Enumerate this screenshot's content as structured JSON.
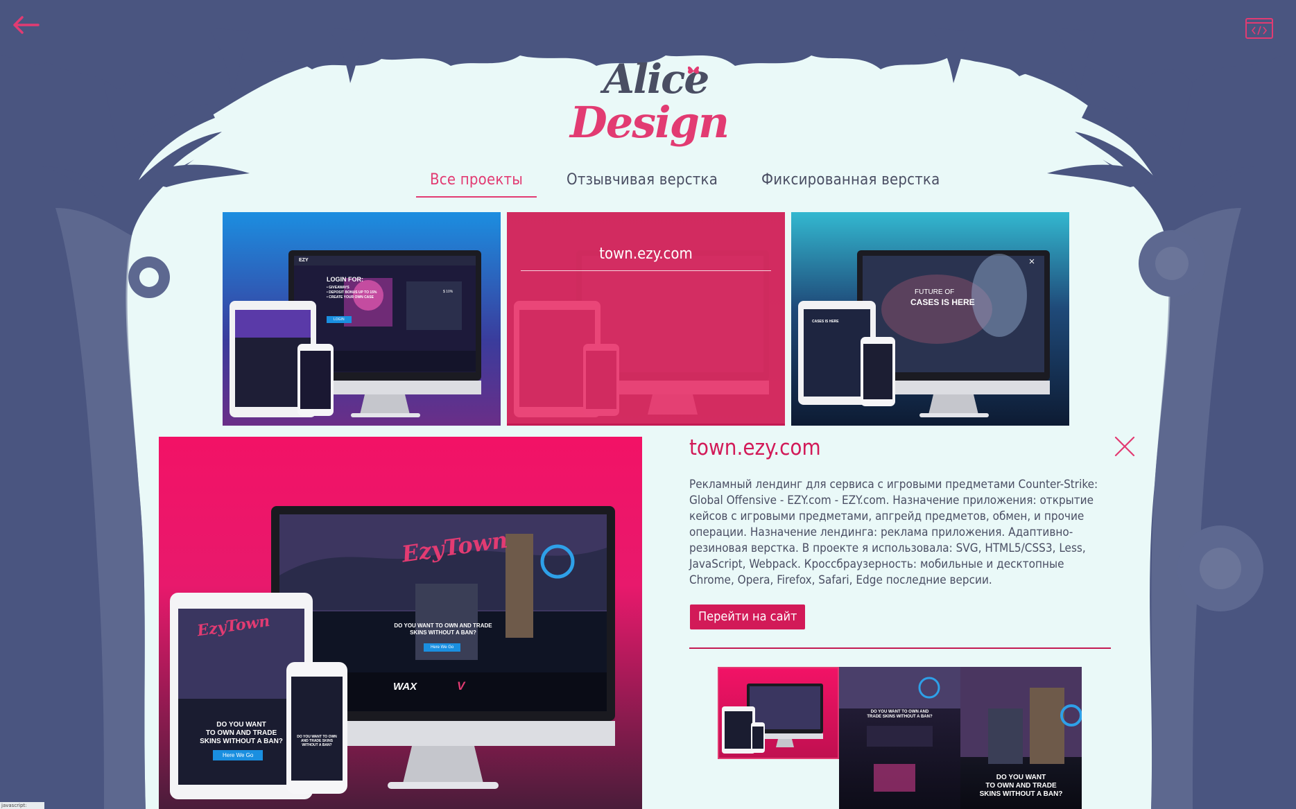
{
  "logo": {
    "line1": "Alice",
    "line2": "Design"
  },
  "tabs": [
    {
      "label": "Все проекты",
      "active": true
    },
    {
      "label": "Отзывчивая верстка",
      "active": false
    },
    {
      "label": "Фиксированная верстка",
      "active": false
    }
  ],
  "projects": [
    {
      "mock": {
        "logo": "EZY",
        "heading": "LOGIN FOR:",
        "bullets": [
          "• GIVEAWAYS",
          "• DEPOSIT BONUS UP TO 15%",
          "• CREATE YOUR OWN CASE"
        ],
        "cta": "LOGIN",
        "price": "$ 10%"
      }
    },
    {
      "title": "town.ezy.com"
    },
    {
      "mock": {
        "line1": "FUTURE OF",
        "line2": "CASES IS HERE",
        "tablet_line": "CASES IS HERE"
      }
    }
  ],
  "detail": {
    "title": "town.ezy.com",
    "description": "Рекламный лендинг для сервиса с игровыми предметами Counter-Strike: Global Offensive - EZY.com - EZY.com. Назначение приложения: открытие кейсов с игровыми предметами, апгрейд предметов, обмен, и прочие операции. Назначение лендинга: реклама приложения. Адаптивно-резиновая верстка. В проекте я использовала: SVG, HTML5/CSS3, Less, JavaScript, Webpack. Кроссбраузерность: мобильные и десктопные Chrome, Opera, Firefox, Safari, Edge последние версии.",
    "visit_label": "Перейти на сайт",
    "mock": {
      "brand": "EzyTown",
      "desktop_question": "DO YOU WANT TO OWN AND TRADE SKINS WITHOUT A BAN?",
      "desktop_cta": "Here We Go",
      "sponsor1": "WAX",
      "sponsor2": "V",
      "tablet_q1": "DO YOU WANT",
      "tablet_q2": "TO OWN AND TRADE",
      "tablet_q3": "SKINS WITHOUT A BAN?",
      "tablet_cta": "Here We Go",
      "phone_q": "DO YOU WANT TO OWN AND TRADE SKINS WITHOUT A BAN?"
    },
    "thumbs": [
      {
        "text": ""
      },
      {
        "text": "DO YOU WANT TO OWN AND TRADE SKINS WITHOUT A BAN?"
      },
      {
        "q1": "DO YOU WANT",
        "q2": "TO OWN AND TRADE",
        "q3": "SKINS WITHOUT A BAN?"
      }
    ]
  },
  "status": {
    "text": "javascript:"
  },
  "colors": {
    "accent": "#e23b72",
    "frame": "#4a5580",
    "stage": "#eaf9f8",
    "button": "#d21a58"
  },
  "icons": {
    "back": "arrow-left-icon",
    "code": "code-icon",
    "close": "close-icon",
    "butterfly": "butterfly-icon"
  }
}
